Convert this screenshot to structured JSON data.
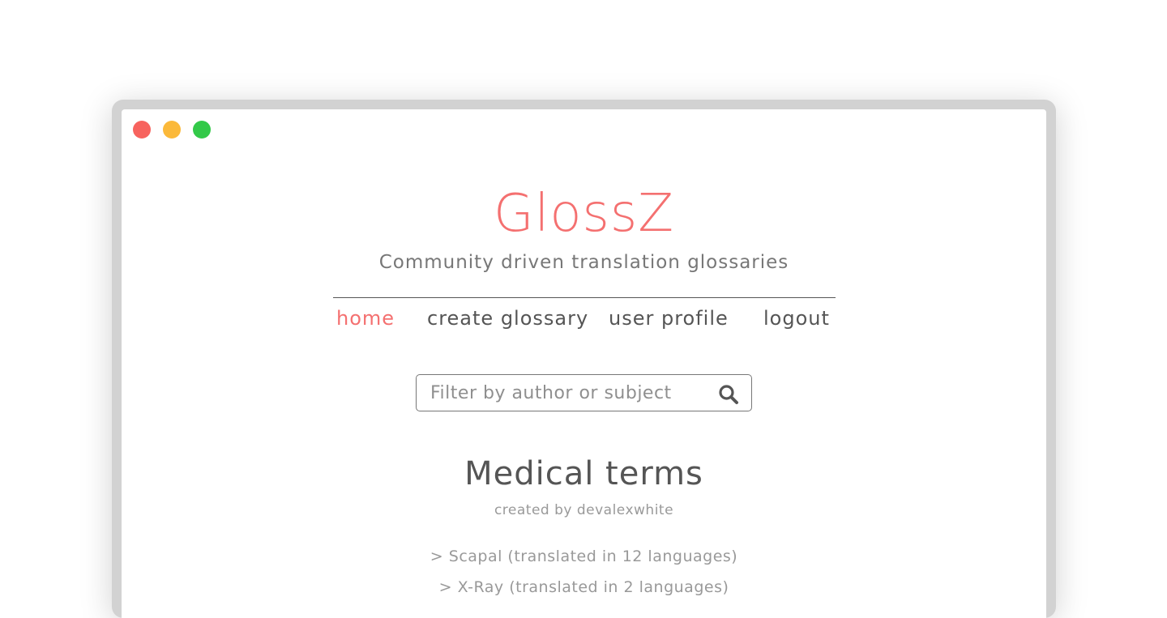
{
  "app": {
    "title": "GlossZ",
    "tagline": "Community driven translation glossaries"
  },
  "nav": {
    "items": [
      {
        "label": "home",
        "active": true
      },
      {
        "label": "create glossary",
        "active": false
      },
      {
        "label": "user profile",
        "active": false
      },
      {
        "label": "logout",
        "active": false
      }
    ]
  },
  "search": {
    "placeholder": "Filter by author or subject",
    "value": "",
    "icon": "search-icon"
  },
  "glossary": {
    "title": "Medical terms",
    "author_line": "created by devalexwhite",
    "terms": [
      {
        "label": "> Scapal (translated in 12 languages)"
      },
      {
        "label": "> X-Ray (translated in 2 languages)"
      }
    ]
  },
  "colors": {
    "accent": "#f47070",
    "text": "#555555",
    "muted": "#999999",
    "window_close": "#f7635e",
    "window_minimize": "#fbb93a",
    "window_maximize": "#33c949"
  }
}
